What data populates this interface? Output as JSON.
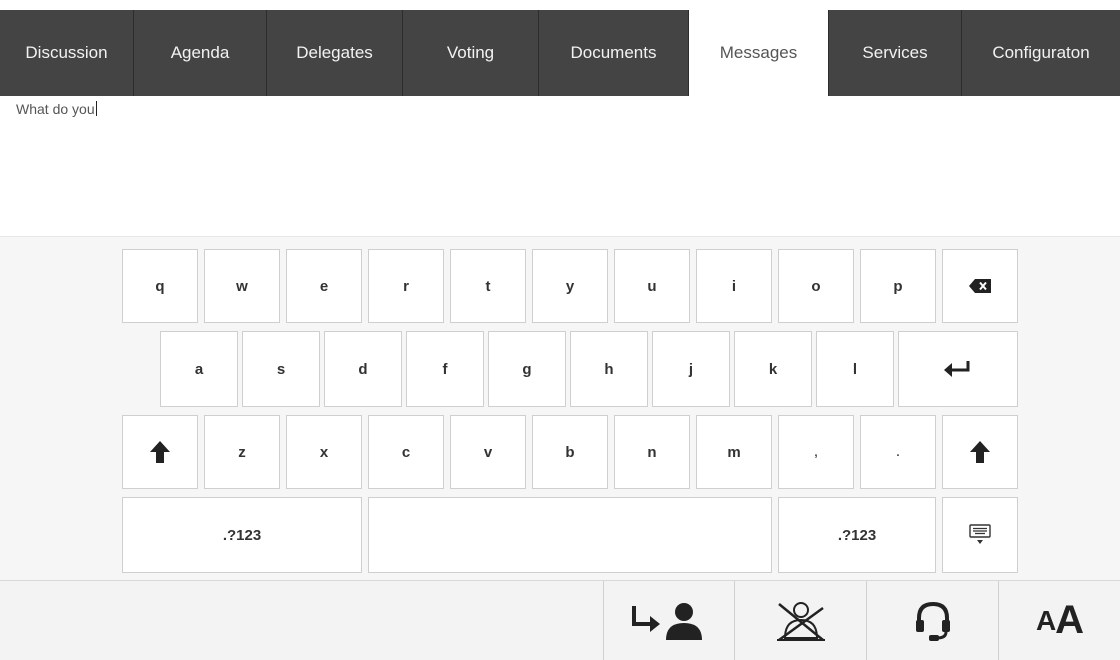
{
  "tabs": [
    {
      "label": "Discussion",
      "active": false
    },
    {
      "label": "Agenda",
      "active": false
    },
    {
      "label": "Delegates",
      "active": false
    },
    {
      "label": "Voting",
      "active": false
    },
    {
      "label": "Documents",
      "active": false
    },
    {
      "label": "Messages",
      "active": true
    },
    {
      "label": "Services",
      "active": false
    },
    {
      "label": "Configuraton",
      "active": false
    }
  ],
  "message": {
    "text": "What do you"
  },
  "keyboard": {
    "row1": [
      "q",
      "w",
      "e",
      "r",
      "t",
      "y",
      "u",
      "i",
      "o",
      "p"
    ],
    "row2": [
      "a",
      "s",
      "d",
      "f",
      "g",
      "h",
      "j",
      "k",
      "l"
    ],
    "row3": [
      "z",
      "x",
      "c",
      "v",
      "b",
      "n",
      "m",
      ",",
      "."
    ],
    "symbols_left": ".?123",
    "symbols_right": ".?123",
    "icons": {
      "backspace": "backspace-icon",
      "enter": "enter-icon",
      "shift": "shift-up-arrow-icon",
      "hide": "hide-keyboard-icon"
    }
  },
  "toolbar": {
    "icons": [
      "transfer-delegate-icon",
      "cancel-delegate-icon",
      "headset-icon"
    ],
    "font_size_small": "A",
    "font_size_big": "A"
  },
  "colors": {
    "tab_bar": "#444444",
    "tab_active": "#ffffff",
    "keyboard_bg": "#f6f6f6",
    "toolbar_bg": "#f3f3f3"
  }
}
